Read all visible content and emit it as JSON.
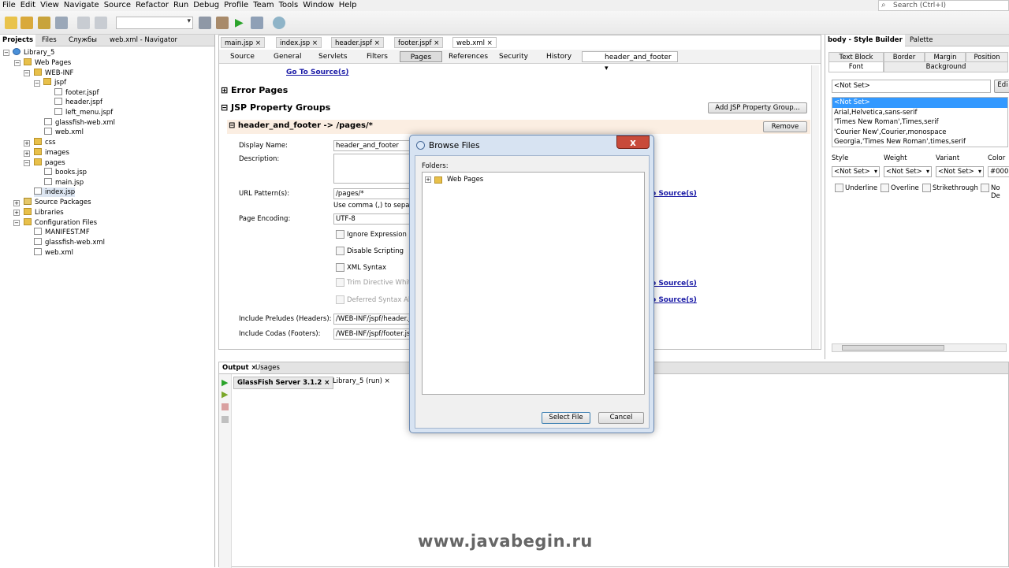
{
  "menu": {
    "items": [
      "File",
      "Edit",
      "View",
      "Navigate",
      "Source",
      "Refactor",
      "Run",
      "Debug",
      "Profile",
      "Team",
      "Tools",
      "Window",
      "Help"
    ]
  },
  "search": {
    "placeholder": "Search (Ctrl+I)"
  },
  "left_panel": {
    "tabs": [
      "Projects",
      "Files",
      "Службы",
      "web.xml - Navigator"
    ],
    "tree": [
      {
        "label": "Library_5",
        "icon": "project-icon"
      },
      {
        "label": "Web Pages",
        "icon": "folder-icon"
      },
      {
        "label": "WEB-INF",
        "icon": "folder-icon"
      },
      {
        "label": "jspf",
        "icon": "folder-icon"
      },
      {
        "label": "footer.jspf",
        "icon": "file-icon"
      },
      {
        "label": "header.jspf",
        "icon": "file-icon"
      },
      {
        "label": "left_menu.jspf",
        "icon": "file-icon"
      },
      {
        "label": "glassfish-web.xml",
        "icon": "file-icon"
      },
      {
        "label": "web.xml",
        "icon": "file-icon"
      },
      {
        "label": "css",
        "icon": "folder-icon"
      },
      {
        "label": "images",
        "icon": "folder-icon"
      },
      {
        "label": "pages",
        "icon": "folder-icon"
      },
      {
        "label": "books.jsp",
        "icon": "file-icon"
      },
      {
        "label": "main.jsp",
        "icon": "file-icon"
      },
      {
        "label": "index.jsp",
        "icon": "file-icon"
      },
      {
        "label": "Source Packages",
        "icon": "package-icon"
      },
      {
        "label": "Libraries",
        "icon": "library-icon"
      },
      {
        "label": "Configuration Files",
        "icon": "folder-icon"
      },
      {
        "label": "MANIFEST.MF",
        "icon": "file-icon"
      },
      {
        "label": "glassfish-web.xml",
        "icon": "file-icon"
      },
      {
        "label": "web.xml",
        "icon": "file-icon"
      }
    ]
  },
  "editor": {
    "tabs": [
      "main.jsp",
      "index.jsp",
      "header.jspf",
      "footer.jspf",
      "web.xml"
    ],
    "view_tabs": [
      "Source",
      "General",
      "Servlets",
      "Filters",
      "Pages",
      "References",
      "Security",
      "History"
    ],
    "group_combo": "header_and_footer",
    "go_to_source": "Go To Source(s)",
    "go_to_source_partial": "o Source(s)",
    "error_pages": "Error Pages",
    "jsp_property_groups": "JSP Property Groups",
    "add_group_button": "Add JSP Property Group...",
    "group_header": "header_and_footer -> /pages/*",
    "remove_button": "Remove",
    "display_name_label": "Display Name:",
    "display_name_value": "header_and_footer",
    "description_label": "Description:",
    "url_pattern_label": "URL Pattern(s):",
    "url_pattern_value": "/pages/*",
    "url_hint": "Use comma (,) to separat",
    "page_encoding_label": "Page Encoding:",
    "page_encoding_value": "UTF-8",
    "checkboxes": [
      "Ignore Expression La",
      "Disable Scripting",
      "XML Syntax",
      "Trim Directive White",
      "Deferred Syntax All"
    ],
    "preludes_label": "Include Preludes (Headers):",
    "preludes_value": "/WEB-INF/jspf/header.js",
    "codas_label": "Include Codas (Footers):",
    "codas_value": "/WEB-INF/jspf/footer.js"
  },
  "style_builder": {
    "tabs": [
      "body - Style Builder",
      "Palette"
    ],
    "sub_tabs": [
      "Text Block",
      "Border",
      "Margin",
      "Position",
      "Font",
      "Background"
    ],
    "font_field": "<Not Set>",
    "edit_label": "Edi",
    "font_list": [
      "<Not Set>",
      "Arial,Helvetica,sans-serif",
      "'Times New Roman',Times,serif",
      "'Courier New',Courier,monospace",
      "Georgia,'Times New Roman',times,serif"
    ],
    "style_label": "Style",
    "weight_label": "Weight",
    "variant_label": "Variant",
    "color_label": "Color",
    "style_value": "<Not Set>",
    "weight_value": "<Not Set>",
    "variant_value": "<Not Set>",
    "color_value": "#000",
    "decorations": [
      "Underline",
      "Overline",
      "Strikethrough",
      "No De"
    ]
  },
  "output": {
    "tabs": [
      "Output",
      "Usages"
    ],
    "sub_tabs": [
      "GlassFish Server 3.1.2",
      "Library_5 (run)"
    ]
  },
  "dialog": {
    "title": "Browse Files",
    "close": "x",
    "folders_label": "Folders:",
    "root_folder": "Web Pages",
    "select_button": "Select File",
    "cancel_button": "Cancel"
  },
  "watermark": "www.javabegin.ru"
}
